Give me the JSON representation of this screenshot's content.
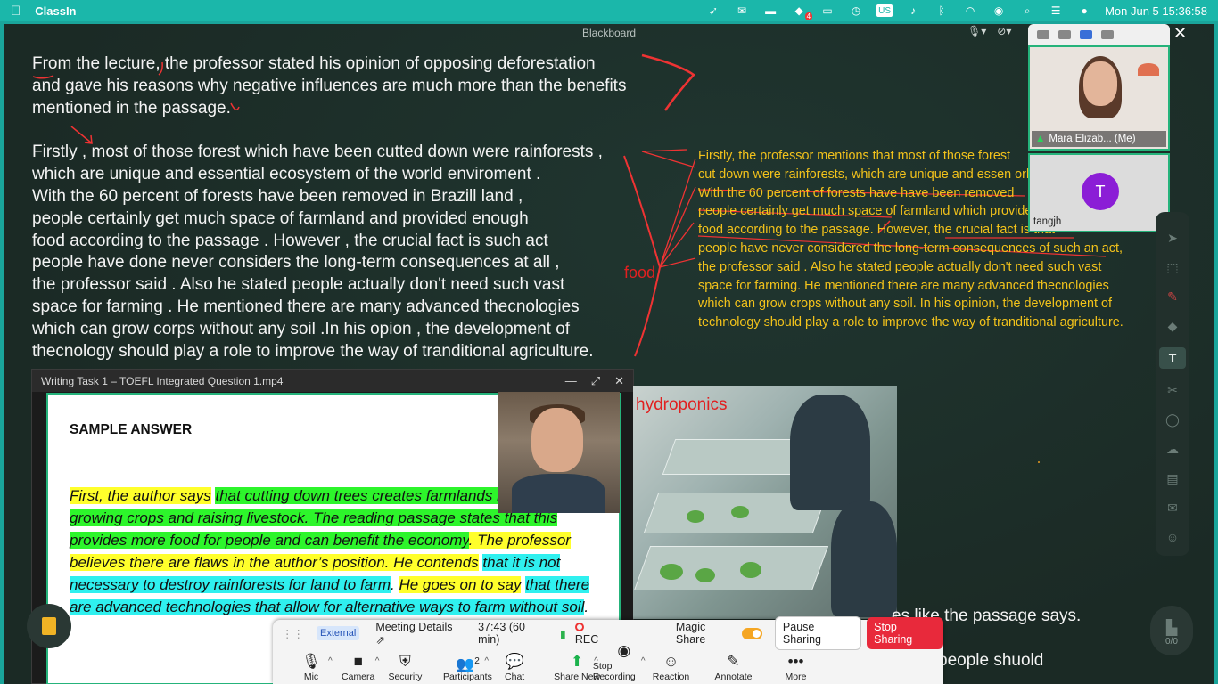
{
  "menubar": {
    "app_name": "ClassIn",
    "clock": "Mon Jun 5  15:36:58",
    "badge": "4",
    "input_source": "US"
  },
  "board": {
    "title": "Blackboard",
    "essay_p1": "From the lecture, the professor stated his opinion of opposing deforestation\nand gave his reasons why negative influences are much more than the benefits\nmentioned in the passage.",
    "essay_p2": "Firstly , most of those forest which have been cutted down were rainforests ,\nwhich are unique and essential ecosystem of the world enviroment .\nWith the 60 percent of forests have been removed in Brazill land ,\npeople certainly get much space of farmland and provided enough\nfood according to the passage . However , the crucial fact is  such act\npeople have done never considers the long-term consequences at all ,\nthe professor said . Also he stated people actually don't need such vast\nspace for farming .  He mentioned there are many advanced thecnologies\nwhich can grow corps without any soil .In his opion , the development of\nthecnology should play a role to improve the way of tranditional agriculture.",
    "revision": "Firstly, the professor mentions that most of those forest\ncut down were rainforests, which are unique and essen         orld.\nWith the 60 percent of forests have have been removed\npeople certainly get much space of farmland which provides enough\nfood according to the passage. However, the crucial fact is that\npeople have never considered the long-term consequences of such an act,\nthe professor said . Also he stated people actually don't need such vast\nspace for farming.  He mentioned there are many advanced thecnologies\nwhich can grow crops without any soil. In his opinion, the development of\ntechnology should play a role to improve the way of tranditional agriculture.",
    "annotation_food": "food",
    "annotation_hydroponics": "hydroponics",
    "bottom_line1": "es like the passage says.",
    "bottom_line2": "people shuold",
    "page_indicator": "0/0"
  },
  "video": {
    "title": "Writing Task 1 – TOEFL Integrated Question 1.mp4",
    "heading": "SAMPLE ANSWER",
    "segments": [
      {
        "text": "First, the author says",
        "hl": "y"
      },
      {
        "text": " ",
        "hl": ""
      },
      {
        "text": "that cutting down trees creates farmlands n",
        "hl": "g"
      },
      {
        "text": "suitable for growing crops and raising livestock. The reading passage states that this provides more food for people and can benefit the economy",
        "hl": "g"
      },
      {
        "text": ". The professor believes there are flaws in the author’s position. He contends",
        "hl": "y"
      },
      {
        "text": " ",
        "hl": ""
      },
      {
        "text": "that it is not necessary to destroy rainforests for land to farm",
        "hl": "c"
      },
      {
        "text": ". ",
        "hl": ""
      },
      {
        "text": "He goes on to say",
        "hl": "y"
      },
      {
        "text": " ",
        "hl": ""
      },
      {
        "text": "that there are advanced technologies that allow for alternative ways to farm without soil",
        "hl": "c"
      },
      {
        "text": ".",
        "hl": ""
      }
    ]
  },
  "participants": [
    {
      "name": "Mara Elizab... (Me)"
    },
    {
      "name": "tangjh",
      "initial": "T",
      "color": "#8b1ed6"
    }
  ],
  "zoom": {
    "external": "External",
    "meeting_details": "Meeting Details",
    "timer": "37:43 (60 min)",
    "rec": "REC",
    "magic_share": "Magic Share",
    "pause_sharing": "Pause Sharing",
    "stop_sharing": "Stop Sharing",
    "participants_count": "2",
    "buttons": [
      {
        "label": "Mic",
        "icon": "mic-icon"
      },
      {
        "label": "Camera",
        "icon": "camera-icon"
      },
      {
        "label": "Security",
        "icon": "shield-icon"
      },
      {
        "label": "Participants",
        "icon": "people-icon"
      },
      {
        "label": "Chat",
        "icon": "chat-icon"
      },
      {
        "label": "Share New",
        "icon": "share-icon"
      },
      {
        "label": "Stop Recording",
        "icon": "stop-record-icon"
      },
      {
        "label": "Reaction",
        "icon": "smile-icon"
      },
      {
        "label": "Annotate",
        "icon": "pen-icon"
      },
      {
        "label": "More",
        "icon": "more-icon"
      }
    ]
  }
}
